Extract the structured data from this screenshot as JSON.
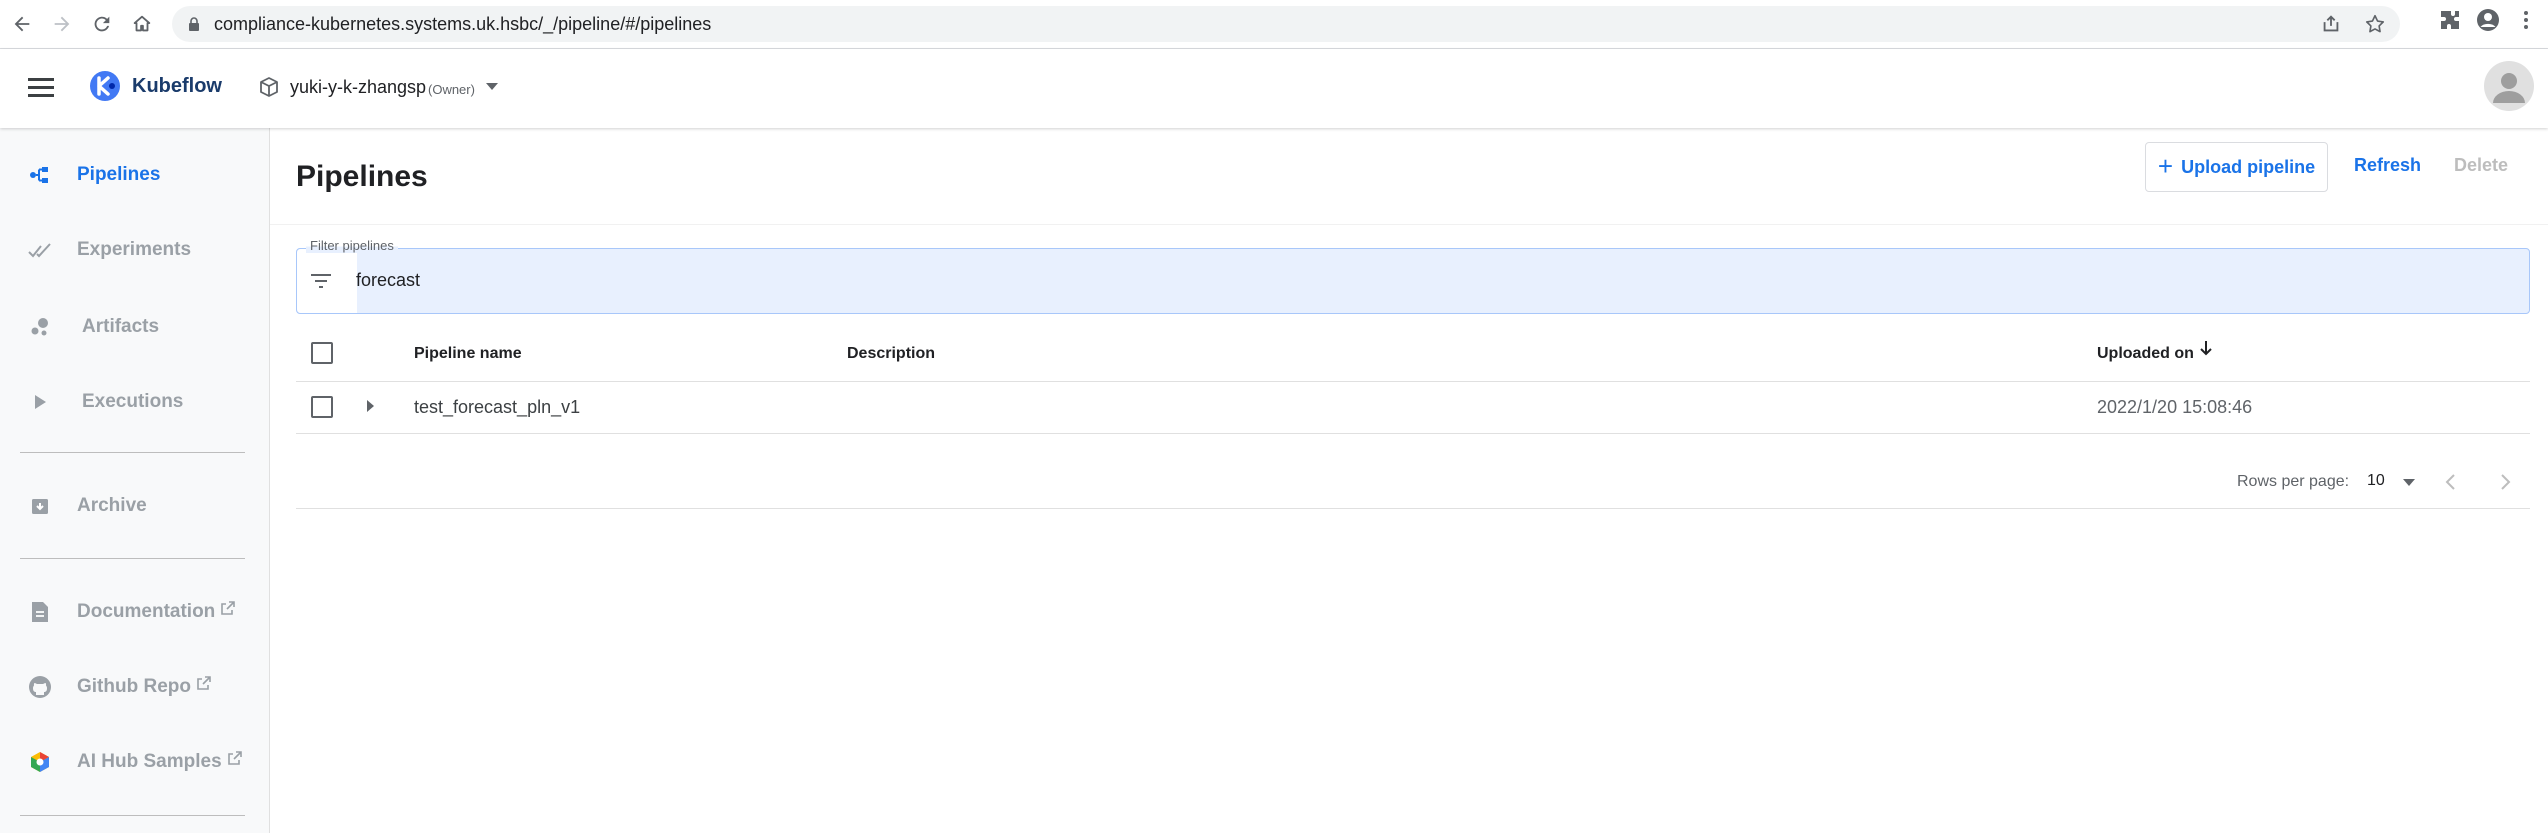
{
  "browser": {
    "url": "compliance-kubernetes.systems.uk.hsbc/_/pipeline/#/pipelines"
  },
  "app": {
    "title": "Kubeflow",
    "namespace": "yuki-y-k-zhangsp",
    "namespace_role": "(Owner)"
  },
  "sidebar": {
    "items": [
      {
        "label": "Pipelines",
        "icon": "pipelines-icon",
        "active": true
      },
      {
        "label": "Experiments",
        "icon": "experiments-icon",
        "active": false
      },
      {
        "label": "Artifacts",
        "icon": "artifacts-icon",
        "active": false
      },
      {
        "label": "Executions",
        "icon": "executions-icon",
        "active": false
      },
      {
        "label": "Archive",
        "icon": "archive-icon",
        "active": false
      },
      {
        "label": "Documentation",
        "icon": "document-icon",
        "active": false
      },
      {
        "label": "Github Repo",
        "icon": "github-icon",
        "active": false
      },
      {
        "label": "AI Hub Samples",
        "icon": "ai-hub-icon",
        "active": false
      }
    ]
  },
  "main": {
    "title": "Pipelines",
    "actions": {
      "upload": "Upload pipeline",
      "refresh": "Refresh",
      "delete": "Delete"
    },
    "filter": {
      "label": "Filter pipelines",
      "value": "forecast"
    },
    "table": {
      "columns": [
        "Pipeline name",
        "Description",
        "Uploaded on"
      ],
      "rows": [
        {
          "name": "test_forecast_pln_v1",
          "description": "",
          "uploaded_on": "2022/1/20 15:08:46"
        }
      ]
    },
    "pagination": {
      "rows_per_page_label": "Rows per page:",
      "rows_per_page": "10"
    }
  },
  "colors": {
    "accent": "#1a73e8",
    "brand": "#1a3b6b",
    "muted": "#9aa0a6"
  }
}
